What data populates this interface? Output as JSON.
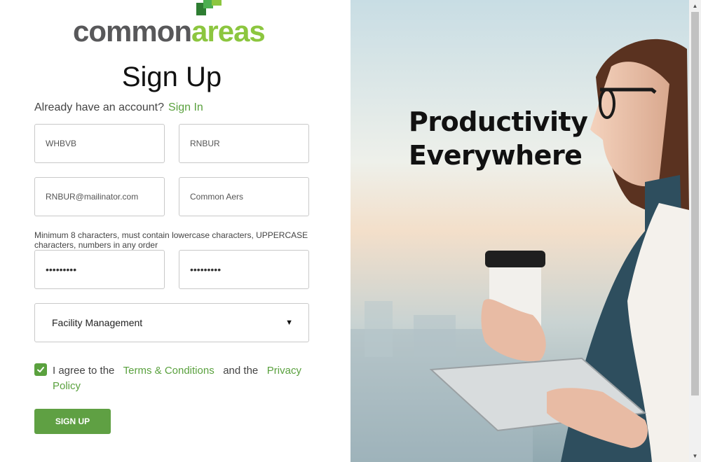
{
  "brand": {
    "part1": "common",
    "part2": "areas",
    "color_gray": "#58585a",
    "color_green": "#8cc63f"
  },
  "form": {
    "title": "Sign Up",
    "have_account": "Already have an account?",
    "sign_in": "Sign In",
    "first_name": "WHBVB",
    "last_name": "RNBUR",
    "email": "RNBUR@mailinator.com",
    "company": "Common Aers",
    "password_hint": "Minimum 8 characters, must contain lowercase characters, UPPERCASE characters, numbers in any order",
    "password": "•••••••••",
    "confirm_password": "•••••••••",
    "role_selected": "Facility Management",
    "agree_prefix": "I agree to the",
    "terms": "Terms & Conditions",
    "and_the": "and the",
    "privacy": "Privacy Policy",
    "agree_checked": true,
    "submit": "SIGN UP",
    "accent": "#5aa13e"
  },
  "hero": {
    "line1": "Productivity",
    "line2": "Everywhere"
  },
  "icons": {
    "dropdown": "caret-down-icon",
    "check": "checkmark-icon",
    "logo": "logo-squares-icon"
  }
}
